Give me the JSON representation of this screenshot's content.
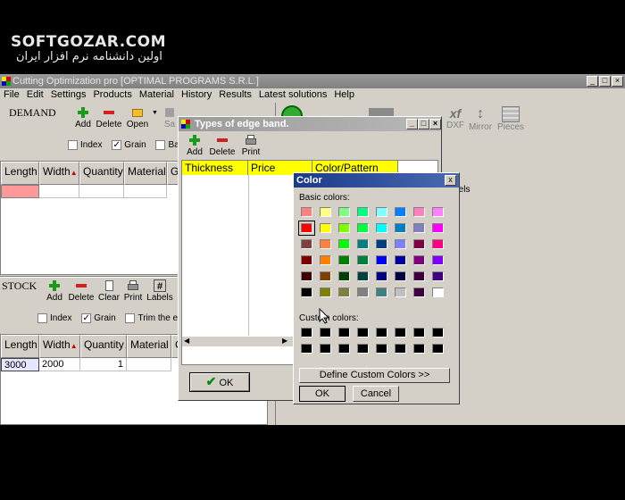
{
  "watermark": {
    "line1": "SOFTGOZAR.COM",
    "line2": "اولین دانشنامه نرم افزار ایران"
  },
  "app": {
    "title": "Cutting Optimization pro [OPTIMAL PROGRAMS S.R.L.]",
    "menu": [
      "File",
      "Edit",
      "Settings",
      "Products",
      "Material",
      "History",
      "Results",
      "Latest solutions",
      "Help"
    ],
    "right_toolbar": {
      "dxf_label": "DXF",
      "dxf_icon": "xf",
      "mirror": "Mirror",
      "pieces": "Pieces",
      "panels": "panels"
    }
  },
  "demand": {
    "label": "DEMAND",
    "toolbar": {
      "add": "Add",
      "delete": "Delete",
      "open": "Open",
      "save": "Sa"
    },
    "options": {
      "index": "Index",
      "grain": "Grain",
      "band": "Ban"
    },
    "columns": [
      "Length",
      "Width",
      "Quantity",
      "Material",
      "G"
    ]
  },
  "stock": {
    "label": "STOCK",
    "toolbar": {
      "add": "Add",
      "delete": "Delete",
      "clear": "Clear",
      "print": "Print",
      "labels": "Labels"
    },
    "options": {
      "index": "Index",
      "grain": "Grain",
      "trim": "Trim the edg"
    },
    "columns": [
      "Length",
      "Width",
      "Quantity",
      "Material",
      "C"
    ],
    "rows": [
      {
        "length": "3000",
        "width": "2000",
        "quantity": "1",
        "material": ""
      }
    ]
  },
  "edge_dialog": {
    "title": "Types of edge band.",
    "toolbar": {
      "add": "Add",
      "delete": "Delete",
      "print": "Print"
    },
    "columns": [
      "Thickness",
      "Price",
      "Color/Pattern"
    ],
    "ok": "OK"
  },
  "color_dialog": {
    "title": "Color",
    "basic_label": "Basic colors:",
    "custom_label": "Custom colors:",
    "define_button": "Define Custom Colors >>",
    "ok": "OK",
    "cancel": "Cancel",
    "close": "x",
    "basic_colors": [
      [
        "#ff8080",
        "#ffff80",
        "#80ff80",
        "#00ff80",
        "#80ffff",
        "#0080ff",
        "#ff80c0",
        "#ff80ff"
      ],
      [
        "#ff0000",
        "#ffff00",
        "#80ff00",
        "#00ff40",
        "#00ffff",
        "#0080c0",
        "#8080c0",
        "#ff00ff"
      ],
      [
        "#804040",
        "#ff8040",
        "#00ff00",
        "#008080",
        "#004080",
        "#8080ff",
        "#800040",
        "#ff0080"
      ],
      [
        "#800000",
        "#ff8000",
        "#008000",
        "#008040",
        "#0000ff",
        "#0000a0",
        "#800080",
        "#8000ff"
      ],
      [
        "#400000",
        "#804000",
        "#004000",
        "#004040",
        "#000080",
        "#000040",
        "#400040",
        "#400080"
      ],
      [
        "#000000",
        "#808000",
        "#808040",
        "#808080",
        "#408080",
        "#c0c0c0",
        "#400040",
        "#ffffff"
      ]
    ],
    "custom_colors": [
      [
        "#000000",
        "#000000",
        "#000000",
        "#000000",
        "#000000",
        "#000000",
        "#000000",
        "#000000"
      ],
      [
        "#000000",
        "#000000",
        "#000000",
        "#000000",
        "#000000",
        "#000000",
        "#000000",
        "#000000"
      ]
    ],
    "selected": "#ff0000"
  }
}
